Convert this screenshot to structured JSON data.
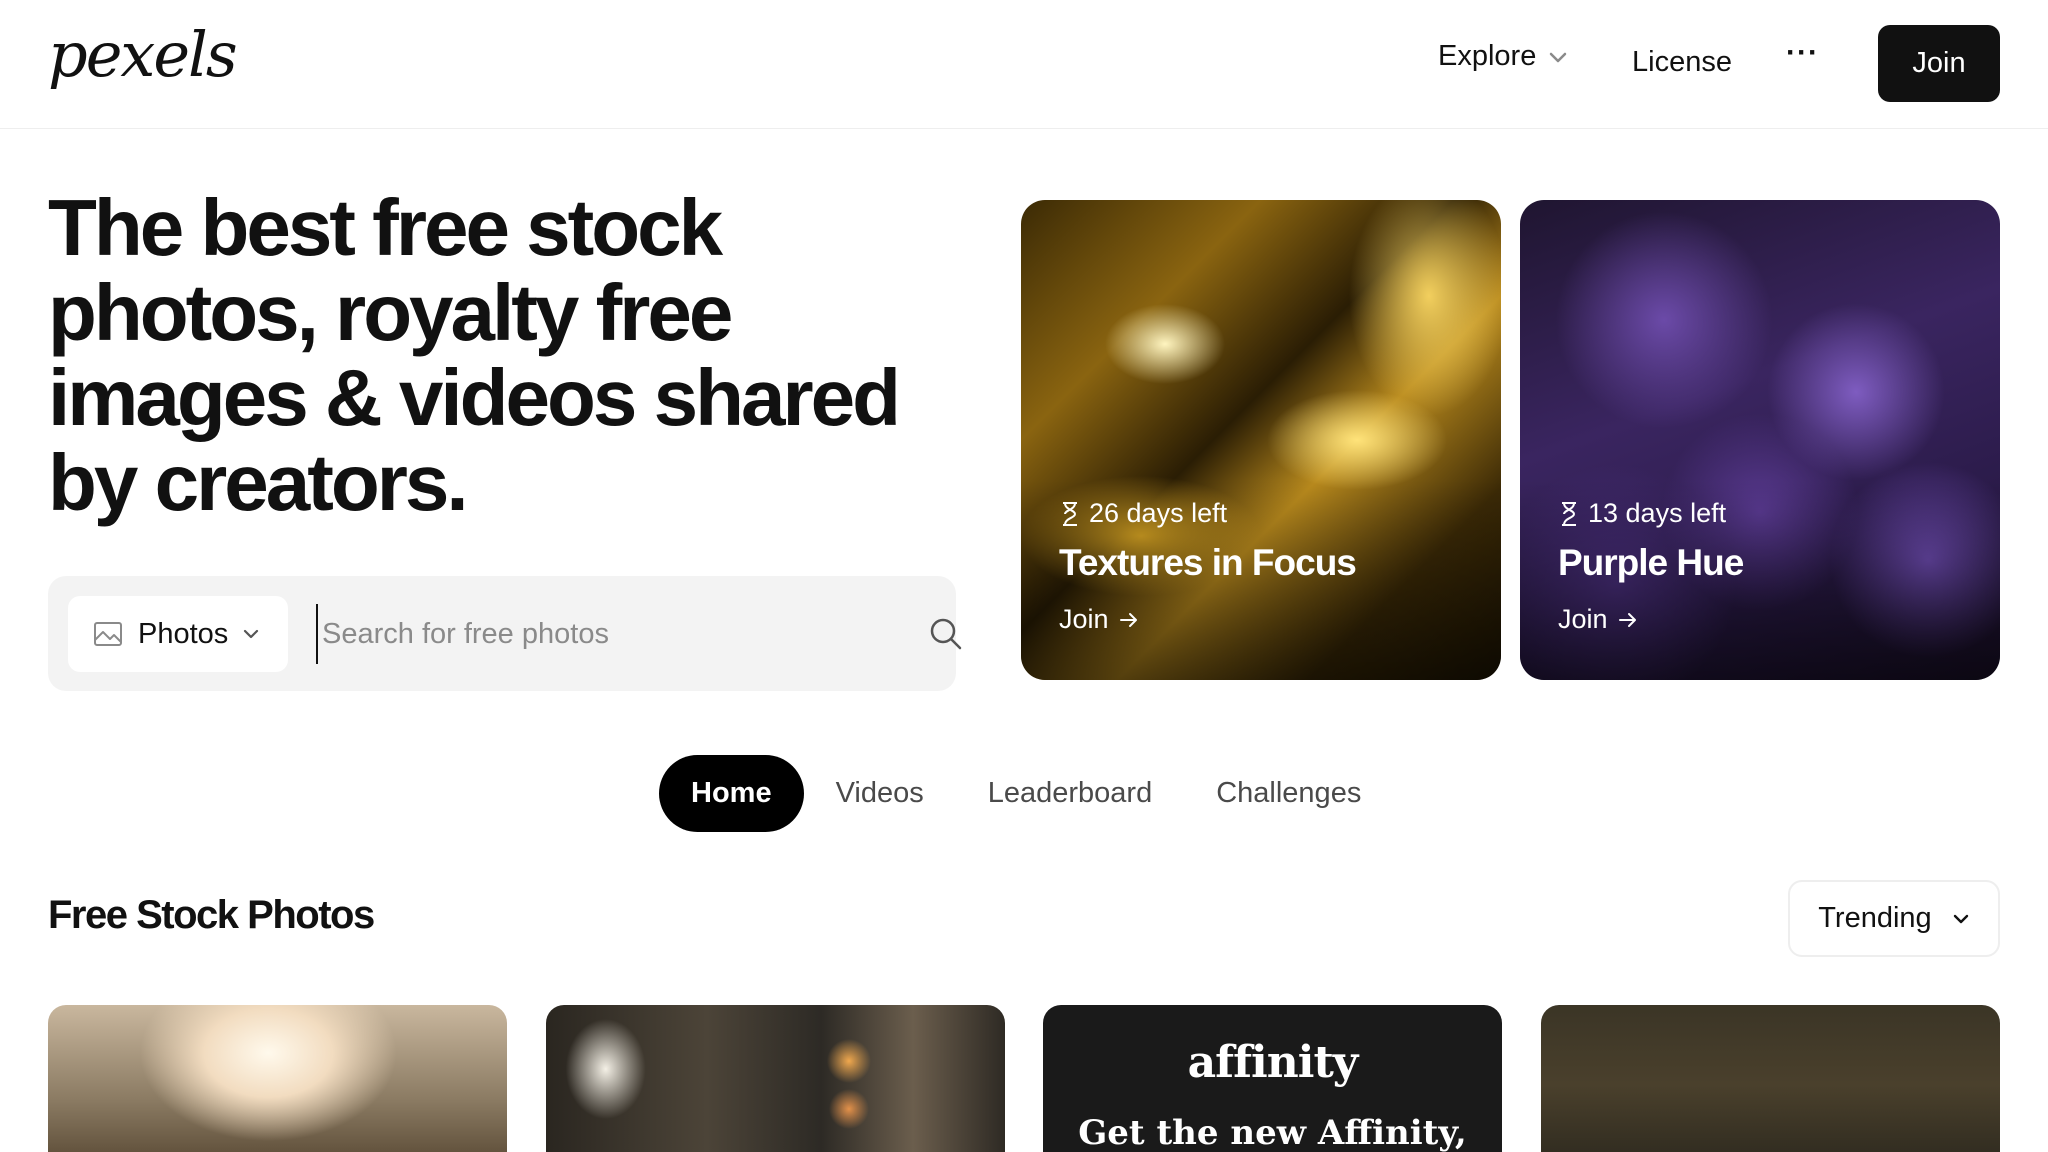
{
  "header": {
    "logo": "pexels",
    "nav": {
      "explore": "Explore",
      "license": "License",
      "more": "···",
      "join": "Join"
    }
  },
  "hero": {
    "title": "The best free stock photos, royalty free images & videos shared by creators.",
    "search": {
      "type_label": "Photos",
      "placeholder": "Search for free photos",
      "value": ""
    }
  },
  "challenges": [
    {
      "days_left": "26 days left",
      "title": "Textures in Focus",
      "join": "Join"
    },
    {
      "days_left": "13 days left",
      "title": "Purple Hue",
      "join": "Join"
    }
  ],
  "tabs": [
    {
      "label": "Home",
      "active": true
    },
    {
      "label": "Videos",
      "active": false
    },
    {
      "label": "Leaderboard",
      "active": false
    },
    {
      "label": "Challenges",
      "active": false
    }
  ],
  "section": {
    "title": "Free Stock Photos",
    "sort_label": "Trending"
  },
  "ad": {
    "brand": "affinity",
    "tagline": "Get the new Affinity,"
  },
  "colors": {
    "primary": "#111111",
    "search_bg": "#f3f3f3",
    "active_tab": "#000000"
  }
}
